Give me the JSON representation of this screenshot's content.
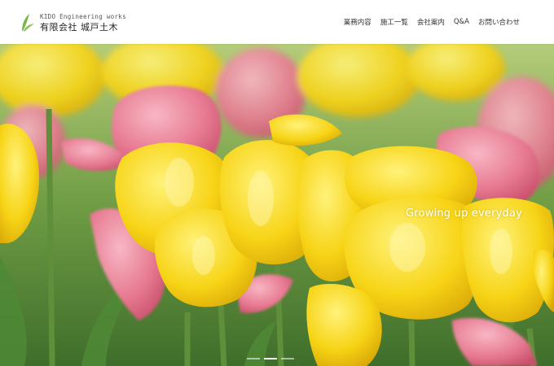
{
  "header": {
    "logo": {
      "en": "KIDO Engineering works",
      "ja": "有限会社  城戸土木",
      "icon": "leaf-logo-icon",
      "accent": "#7ab648"
    },
    "nav": [
      {
        "label": "業務内容"
      },
      {
        "label": "施工一覧"
      },
      {
        "label": "会社案内"
      },
      {
        "label": "Q&A"
      },
      {
        "label": "お問い合わせ"
      }
    ]
  },
  "hero": {
    "tagline": "Growing up everyday",
    "slides": {
      "count": 3,
      "active": 2
    },
    "colors": {
      "yellow": "#f5d21c",
      "pink": "#e87a93",
      "green": "#6b9a4a"
    }
  }
}
